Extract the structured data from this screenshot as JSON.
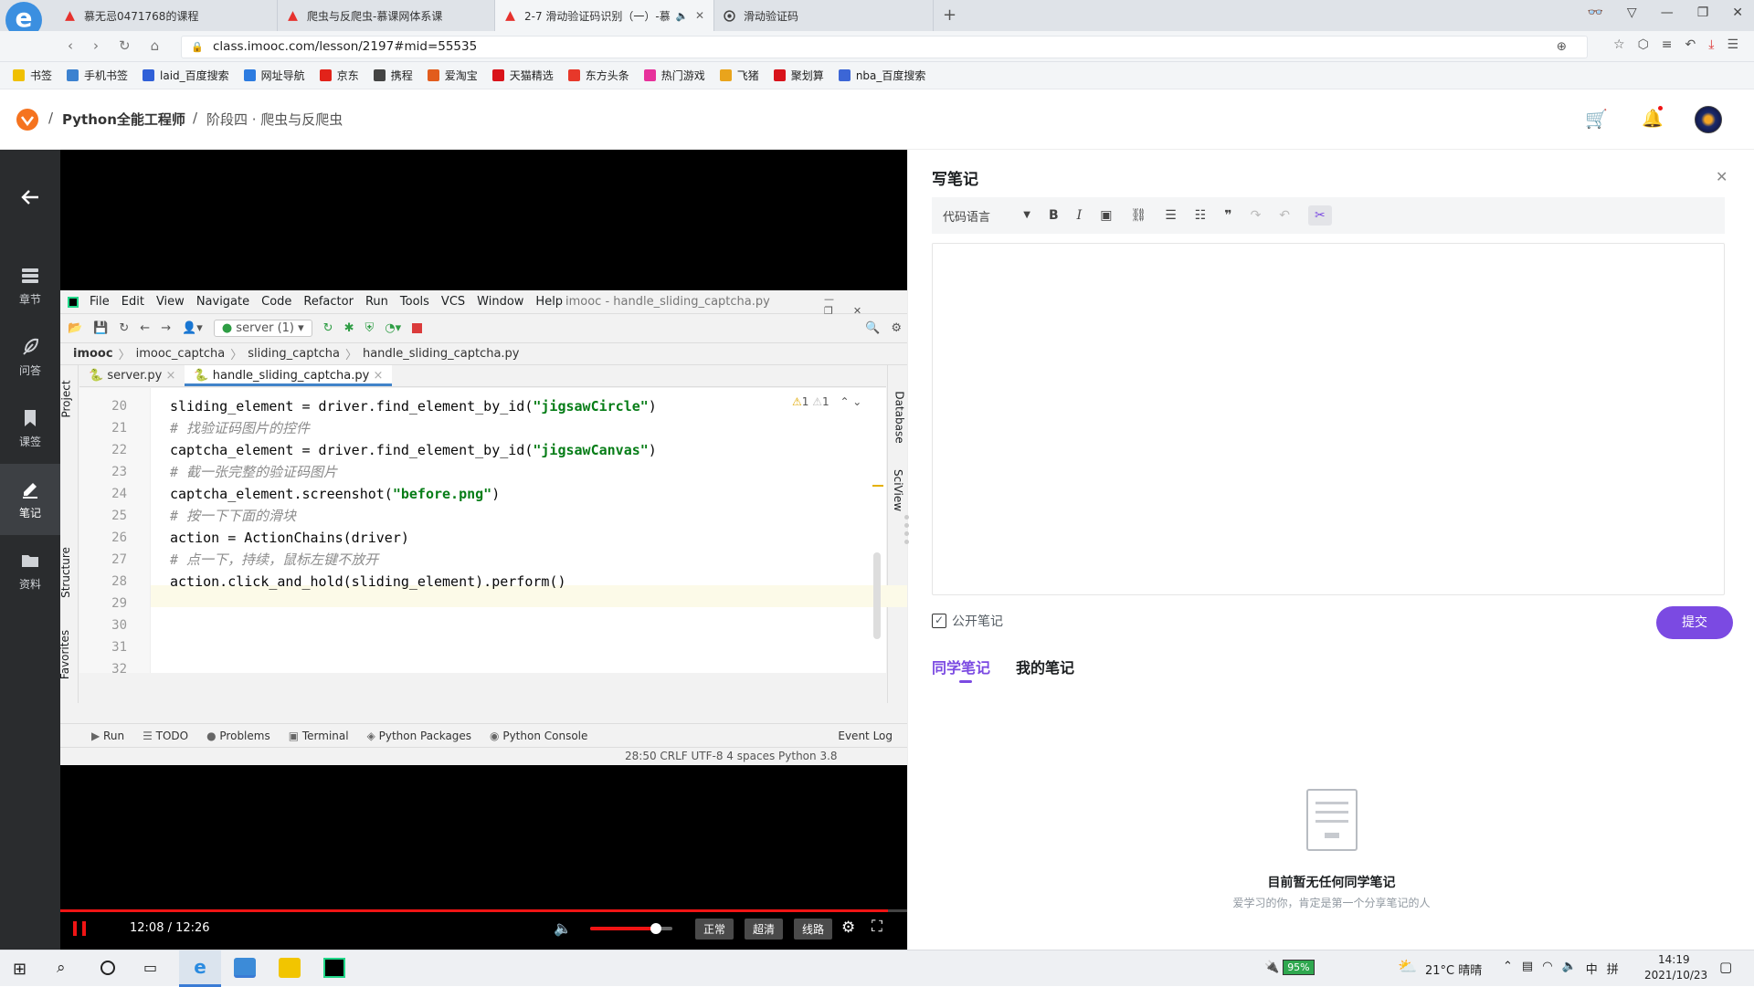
{
  "browser": {
    "tabs": [
      {
        "title": "慕无忌0471768的课程",
        "active": false
      },
      {
        "title": "爬虫与反爬虫-慕课网体系课",
        "active": false
      },
      {
        "title": "2-7 滑动验证码识别（一）-慕",
        "active": true
      },
      {
        "title": "滑动验证码",
        "active": false
      }
    ],
    "url": "class.imooc.com/lesson/2197#mid=55535",
    "bookmarks": [
      "书签",
      "手机书签",
      "laid_百度搜索",
      "网址导航",
      "京东",
      "携程",
      "爱淘宝",
      "天猫精选",
      "东方头条",
      "热门游戏",
      "飞猪",
      "聚划算",
      "nba_百度搜索"
    ]
  },
  "site": {
    "course": "Python全能工程师",
    "stage": "阶段四 · 爬虫与反爬虫"
  },
  "leftnav": [
    {
      "label": "章节",
      "icon": "layers-icon"
    },
    {
      "label": "问答",
      "icon": "feather-icon"
    },
    {
      "label": "课签",
      "icon": "bookmark-icon"
    },
    {
      "label": "笔记",
      "icon": "pen-icon",
      "active": true
    },
    {
      "label": "资料",
      "icon": "folder-icon"
    }
  ],
  "ide": {
    "menu": [
      "File",
      "Edit",
      "View",
      "Navigate",
      "Code",
      "Refactor",
      "Run",
      "Tools",
      "VCS",
      "Window",
      "Help"
    ],
    "window_title": "imooc - handle_sliding_captcha.py",
    "run_config": "server (1)",
    "breadcrumbs": [
      "imooc",
      "imooc_captcha",
      "sliding_captcha",
      "handle_sliding_captcha.py"
    ],
    "file_tabs": [
      "server.py",
      "handle_sliding_captcha.py"
    ],
    "warnings": "⚠1 ⚠1",
    "code": [
      {
        "n": "20",
        "parts": [
          [
            "sliding_element = driver.find_element_by_id(",
            ""
          ],
          [
            "\"jigsawCircle\"",
            "str"
          ],
          [
            ")",
            ""
          ]
        ]
      },
      {
        "n": "21",
        "parts": [
          [
            "# 找验证码图片的控件",
            "cm"
          ]
        ]
      },
      {
        "n": "22",
        "parts": [
          [
            "captcha_element = driver.find_element_by_id(",
            ""
          ],
          [
            "\"jigsawCanvas\"",
            "str"
          ],
          [
            ")",
            ""
          ]
        ]
      },
      {
        "n": "23",
        "parts": [
          [
            "# 截一张完整的验证码图片",
            "cm"
          ]
        ]
      },
      {
        "n": "24",
        "parts": [
          [
            "captcha_element.screenshot(",
            ""
          ],
          [
            "\"before.png\"",
            "str"
          ],
          [
            ")",
            ""
          ]
        ]
      },
      {
        "n": "25",
        "parts": [
          [
            "# 按一下下面的滑块",
            "cm"
          ]
        ]
      },
      {
        "n": "26",
        "parts": [
          [
            "action = ActionChains(driver)",
            ""
          ]
        ]
      },
      {
        "n": "27",
        "parts": [
          [
            "# 点一下，持续，鼠标左键不放开",
            "cm"
          ]
        ]
      },
      {
        "n": "28",
        "parts": [
          [
            "action.click_and_hold(sliding_element).perform()",
            ""
          ]
        ]
      },
      {
        "n": "29",
        "parts": []
      },
      {
        "n": "30",
        "parts": []
      },
      {
        "n": "31",
        "parts": []
      },
      {
        "n": "32",
        "parts": []
      }
    ],
    "side_left": [
      "Project",
      "Structure",
      "Favorites"
    ],
    "side_right": [
      "Database",
      "SciView"
    ],
    "bottom_tabs": [
      "Run",
      "TODO",
      "Problems",
      "Terminal",
      "Python Packages",
      "Python Console"
    ],
    "event_log": "Event Log",
    "status": "28:50  CRLF  UTF-8  4 spaces  Python 3.8"
  },
  "player": {
    "time": "12:08 / 12:26",
    "progress": 0.977,
    "volume": 0.8,
    "speed": "正常",
    "quality": "超清",
    "line": "线路"
  },
  "notes": {
    "title": "写笔记",
    "lang_select": "代码语言",
    "public_label": "公开笔记",
    "submit": "提交",
    "tabs": [
      "同学笔记",
      "我的笔记"
    ],
    "empty_title": "目前暂无任何同学笔记",
    "empty_sub": "爱学习的你，肯定是第一个分享笔记的人"
  },
  "taskbar": {
    "battery": "95%",
    "weather": "21°C 晴晴",
    "ime": "中",
    "ime2": "拼",
    "time": "14:19",
    "date": "2021/10/23"
  },
  "colors": {
    "accent": "#7b4ae2",
    "brand": "#f01414",
    "nav_bg": "#2a2c2e"
  }
}
